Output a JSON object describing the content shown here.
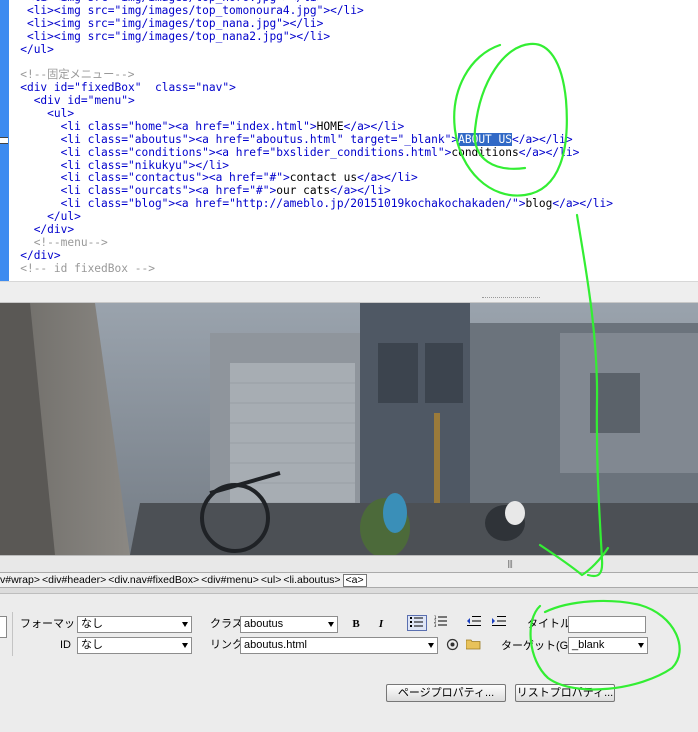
{
  "code_editor": {
    "lines": [
      {
        "indent": 4,
        "parts": [
          {
            "c": "tg",
            "t": "<li><img "
          },
          {
            "c": "at",
            "t": "src="
          },
          {
            "c": "vl",
            "t": "\"img/images/top_noro.jpg\""
          },
          {
            "c": "tg",
            "t": "></li>"
          }
        ]
      },
      {
        "indent": 4,
        "parts": [
          {
            "c": "tg",
            "t": "<li><img "
          },
          {
            "c": "at",
            "t": "src="
          },
          {
            "c": "vl",
            "t": "\"img/images/top_tomonoura4.jpg\""
          },
          {
            "c": "tg",
            "t": "></li>"
          }
        ]
      },
      {
        "indent": 4,
        "parts": [
          {
            "c": "tg",
            "t": "<li><img "
          },
          {
            "c": "at",
            "t": "src="
          },
          {
            "c": "vl",
            "t": "\"img/images/top_nana.jpg\""
          },
          {
            "c": "tg",
            "t": "></li>"
          }
        ]
      },
      {
        "indent": 4,
        "parts": [
          {
            "c": "tg",
            "t": "<li><img "
          },
          {
            "c": "at",
            "t": "src="
          },
          {
            "c": "vl",
            "t": "\"img/images/top_nana2.jpg\""
          },
          {
            "c": "tg",
            "t": "></li>"
          }
        ]
      },
      {
        "indent": 3,
        "parts": [
          {
            "c": "tg",
            "t": "</ul>"
          }
        ]
      },
      {
        "indent": 3,
        "parts": []
      },
      {
        "indent": 3,
        "parts": [
          {
            "c": "cm",
            "t": "<!--固定メニュー-->"
          }
        ]
      },
      {
        "indent": 3,
        "parts": [
          {
            "c": "tg",
            "t": "<div "
          },
          {
            "c": "at",
            "t": "id="
          },
          {
            "c": "vl",
            "t": "\"fixedBox\""
          },
          {
            "c": "tx",
            "t": "  "
          },
          {
            "c": "at",
            "t": "class="
          },
          {
            "c": "vl",
            "t": "\"nav\""
          },
          {
            "c": "tg",
            "t": ">"
          }
        ]
      },
      {
        "indent": 5,
        "parts": [
          {
            "c": "tg",
            "t": "<div "
          },
          {
            "c": "at",
            "t": "id="
          },
          {
            "c": "vl",
            "t": "\"menu\""
          },
          {
            "c": "tg",
            "t": ">"
          }
        ]
      },
      {
        "indent": 7,
        "parts": [
          {
            "c": "tg",
            "t": "<ul>"
          }
        ]
      },
      {
        "indent": 9,
        "parts": [
          {
            "c": "tg",
            "t": "<li "
          },
          {
            "c": "at",
            "t": "class="
          },
          {
            "c": "vl",
            "t": "\"home\""
          },
          {
            "c": "tg",
            "t": "><a "
          },
          {
            "c": "at",
            "t": "href="
          },
          {
            "c": "vl",
            "t": "\"index.html\""
          },
          {
            "c": "tg",
            "t": ">"
          },
          {
            "c": "tx",
            "t": "HOME"
          },
          {
            "c": "tg",
            "t": "</a></li>"
          }
        ]
      },
      {
        "indent": 9,
        "parts": [
          {
            "c": "tg",
            "t": "<li "
          },
          {
            "c": "at",
            "t": "class="
          },
          {
            "c": "vl",
            "t": "\"aboutus\""
          },
          {
            "c": "tg",
            "t": "><a "
          },
          {
            "c": "at",
            "t": "href="
          },
          {
            "c": "vl",
            "t": "\"aboutus.html\""
          },
          {
            "c": "tx",
            "t": " "
          },
          {
            "c": "at",
            "t": "target="
          },
          {
            "c": "vl",
            "t": "\"_blank\""
          },
          {
            "c": "tg",
            "t": ">"
          },
          {
            "c": "hl",
            "t": "ABOUT US"
          },
          {
            "c": "tg",
            "t": "</a></li>"
          }
        ]
      },
      {
        "indent": 9,
        "parts": [
          {
            "c": "tg",
            "t": "<li "
          },
          {
            "c": "at",
            "t": "class="
          },
          {
            "c": "vl",
            "t": "\"conditions\""
          },
          {
            "c": "tg",
            "t": "><a "
          },
          {
            "c": "at",
            "t": "href="
          },
          {
            "c": "vl",
            "t": "\"bxslider_conditions.html\""
          },
          {
            "c": "tg",
            "t": ">"
          },
          {
            "c": "tx",
            "t": "conditions"
          },
          {
            "c": "tg",
            "t": "</a></li>"
          }
        ]
      },
      {
        "indent": 9,
        "parts": [
          {
            "c": "tg",
            "t": "<li "
          },
          {
            "c": "at",
            "t": "class="
          },
          {
            "c": "vl",
            "t": "\"nikukyu\""
          },
          {
            "c": "tg",
            "t": "></li>"
          }
        ]
      },
      {
        "indent": 9,
        "parts": [
          {
            "c": "tg",
            "t": "<li "
          },
          {
            "c": "at",
            "t": "class="
          },
          {
            "c": "vl",
            "t": "\"contactus\""
          },
          {
            "c": "tg",
            "t": "><a "
          },
          {
            "c": "at",
            "t": "href="
          },
          {
            "c": "vl",
            "t": "\"#\""
          },
          {
            "c": "tg",
            "t": ">"
          },
          {
            "c": "tx",
            "t": "contact us"
          },
          {
            "c": "tg",
            "t": "</a></li>"
          }
        ]
      },
      {
        "indent": 9,
        "parts": [
          {
            "c": "tg",
            "t": "<li "
          },
          {
            "c": "at",
            "t": "class="
          },
          {
            "c": "vl",
            "t": "\"ourcats\""
          },
          {
            "c": "tg",
            "t": "><a "
          },
          {
            "c": "at",
            "t": "href="
          },
          {
            "c": "vl",
            "t": "\"#\""
          },
          {
            "c": "tg",
            "t": ">"
          },
          {
            "c": "tx",
            "t": "our cats"
          },
          {
            "c": "tg",
            "t": "</a></li>"
          }
        ]
      },
      {
        "indent": 9,
        "parts": [
          {
            "c": "tg",
            "t": "<li "
          },
          {
            "c": "at",
            "t": "class="
          },
          {
            "c": "vl",
            "t": "\"blog\""
          },
          {
            "c": "tg",
            "t": "><a "
          },
          {
            "c": "at",
            "t": "href="
          },
          {
            "c": "vl",
            "t": "\"http://ameblo.jp/20151019kochakochakaden/\""
          },
          {
            "c": "tg",
            "t": ">"
          },
          {
            "c": "tx",
            "t": "blog"
          },
          {
            "c": "tg",
            "t": "</a></li>"
          }
        ]
      },
      {
        "indent": 7,
        "parts": [
          {
            "c": "tg",
            "t": "</ul>"
          }
        ]
      },
      {
        "indent": 5,
        "parts": [
          {
            "c": "tg",
            "t": "</div>"
          }
        ]
      },
      {
        "indent": 5,
        "parts": [
          {
            "c": "cm",
            "t": "<!--menu-->"
          }
        ]
      },
      {
        "indent": 3,
        "parts": [
          {
            "c": "tg",
            "t": "</div>"
          }
        ]
      },
      {
        "indent": 3,
        "parts": [
          {
            "c": "cm",
            "t": "<!-- id fixedBox -->"
          }
        ]
      }
    ]
  },
  "tag_selector": {
    "crumbs": [
      "v#wrap>",
      "<div#header>",
      "<div.nav#fixedBox>",
      "<div#menu>",
      "<ul>",
      "<li.aboutus>"
    ],
    "active": "<a>"
  },
  "properties": {
    "format_label": "フォーマット",
    "format_value": "なし",
    "id_label": "ID",
    "id_value": "なし",
    "class_label": "クラス",
    "class_value": "aboutus",
    "bold_label": "B",
    "italic_label": "I",
    "link_label": "リンク",
    "link_value": "aboutus.html",
    "title_label": "タイトル",
    "title_value": "",
    "target_label": "ターゲット(G)",
    "target_value": "_blank",
    "page_props_label": "ページプロパティ...",
    "list_props_label": "リストプロパティ..."
  },
  "colors": {
    "tag": "#0000cc",
    "comment": "#999999",
    "selection": "#3169c6",
    "annotation": "#33ee33",
    "gutter": "#3d8bf0"
  },
  "icons": [
    "bold-icon",
    "italic-icon",
    "unordered-list-icon",
    "ordered-list-icon",
    "outdent-icon",
    "indent-icon",
    "point-to-file-icon",
    "folder-icon"
  ]
}
